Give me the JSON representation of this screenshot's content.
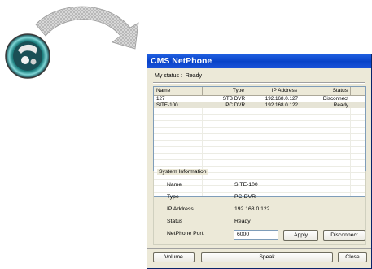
{
  "window": {
    "title": "CMS NetPhone"
  },
  "my_status": {
    "label": "My status :",
    "value": "Ready"
  },
  "list": {
    "columns": [
      "Name",
      "Type",
      "IP Address",
      "Status"
    ],
    "rows": [
      {
        "name": "127",
        "type": "STB DVR",
        "ip": "192.168.0.127",
        "status": "Disconnect"
      },
      {
        "name": "SITE-100",
        "type": "PC DVR",
        "ip": "192.168.0.122",
        "status": "Ready"
      }
    ]
  },
  "system_info": {
    "legend": "System Information",
    "labels": {
      "name": "Name",
      "type": "Type",
      "ip": "IP Address",
      "status": "Status",
      "port": "NetPhone Port"
    },
    "values": {
      "name": "SITE-100",
      "type": "PC-DVR",
      "ip": "192.168.0.122",
      "status": "Ready",
      "port": "6000"
    }
  },
  "buttons": {
    "apply": "Apply",
    "disconnect": "Disconnect",
    "volume": "Volume",
    "speak": "Speak",
    "close": "Close"
  },
  "colors": {
    "title_bar": "#0842c8",
    "window_bg": "#ece9d8",
    "selected_row": "#e6e4d6"
  },
  "icons": {
    "app_icon": "netphone-dial-icon",
    "arrow": "curved-arrow-icon"
  }
}
